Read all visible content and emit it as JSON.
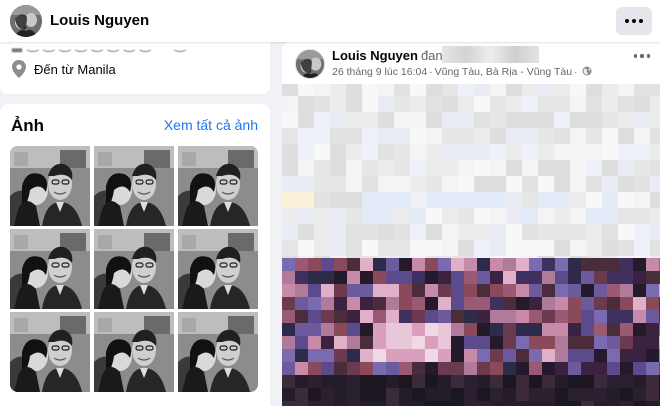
{
  "header": {
    "profile_name": "Louis Nguyen",
    "menu_icon": "more-horizontal-icon"
  },
  "intro": {
    "from_text": "Đến từ Manila",
    "location_icon": "map-pin-icon"
  },
  "photos": {
    "title": "Ảnh",
    "see_all_label": "Xem tất cả ảnh",
    "count": 9
  },
  "post": {
    "author": "Louis Nguyen",
    "verb": "đang ở",
    "date": "26 tháng 9 lúc 16:04",
    "location": "Vũng Tàu, Bà Rịa - Vũng Tàu",
    "separator": "·",
    "privacy_icon": "globe-icon",
    "menu_icon": "more-horizontal-icon"
  }
}
